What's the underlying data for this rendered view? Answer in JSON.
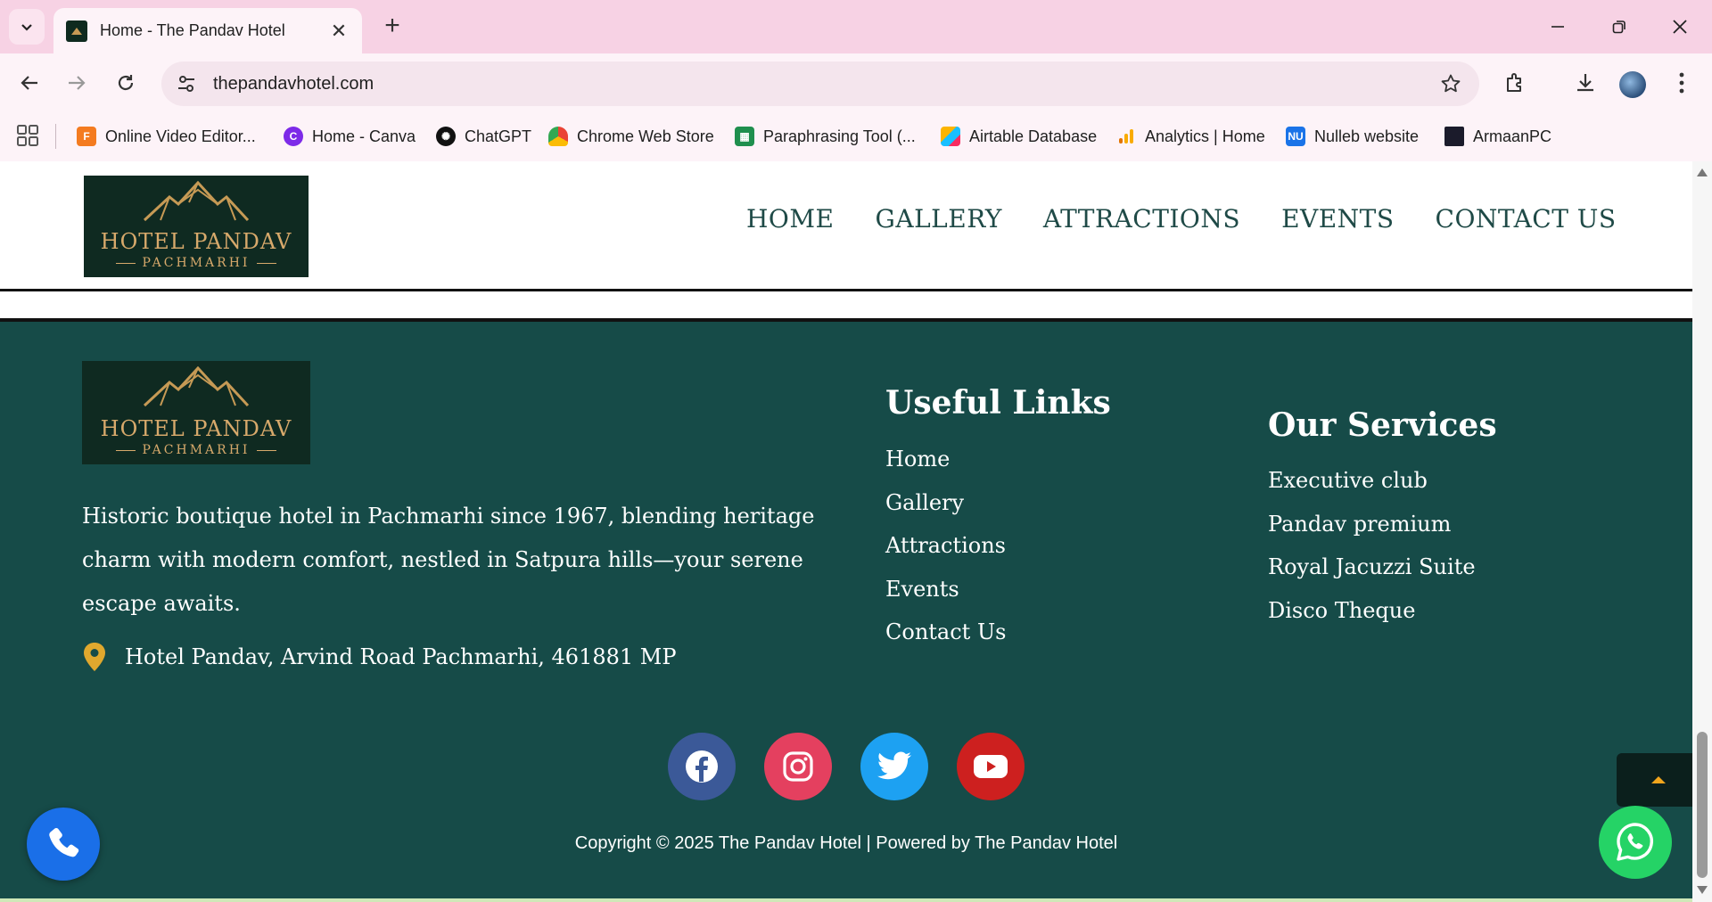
{
  "browser": {
    "tab_title": "Home - The Pandav Hotel",
    "url": "thepandavhotel.com",
    "bookmarks": [
      {
        "label": "Online Video Editor...",
        "icon": "video-editor-icon",
        "color": "#f47b20"
      },
      {
        "label": "Home - Canva",
        "icon": "canva-icon",
        "color": "#7d2ae8"
      },
      {
        "label": "ChatGPT",
        "icon": "chatgpt-icon",
        "color": "#111111"
      },
      {
        "label": "Chrome Web Store",
        "icon": "chrome-web-store-icon",
        "color": "#ea4335"
      },
      {
        "label": "Paraphrasing Tool (...",
        "icon": "paraphrasing-tool-icon",
        "color": "#1f8f4e"
      },
      {
        "label": "Airtable Database",
        "icon": "airtable-icon",
        "color": "#fcb400"
      },
      {
        "label": "Analytics | Home",
        "icon": "analytics-icon",
        "color": "#f9ab00"
      },
      {
        "label": "Nulleb website",
        "icon": "nulleb-icon",
        "color": "#1a73e8"
      },
      {
        "label": "ArmaanPC",
        "icon": "armaanpc-icon",
        "color": "#1b1b2b"
      }
    ],
    "nulleb_badge": "NU"
  },
  "header": {
    "logo": {
      "name": "HOTEL PANDAV",
      "sub": "PACHMARHI"
    },
    "nav": [
      "HOME",
      "GALLERY",
      "ATTRACTIONS",
      "EVENTS",
      "CONTACT US"
    ]
  },
  "footer": {
    "logo": {
      "name": "HOTEL PANDAV",
      "sub": "PACHMARHI"
    },
    "description": "Historic boutique hotel in Pachmarhi since 1967, blending heritage charm with modern comfort, nestled in Satpura hills—your serene escape awaits.",
    "address": "Hotel Pandav, Arvind Road Pachmarhi, 461881 MP",
    "useful_links": {
      "title": "Useful Links",
      "items": [
        "Home",
        "Gallery",
        "Attractions",
        "Events",
        "Contact Us"
      ]
    },
    "services": {
      "title": "Our Services",
      "items": [
        "Executive club",
        "Pandav premium",
        "Royal Jacuzzi Suite",
        "Disco Theque"
      ]
    },
    "social": [
      {
        "name": "facebook-icon",
        "color": "#3b5998"
      },
      {
        "name": "instagram-icon",
        "color": "#e4405f"
      },
      {
        "name": "twitter-icon",
        "color": "#1da1f2"
      },
      {
        "name": "youtube-icon",
        "color": "#cd201f"
      }
    ],
    "copyright": "Copyright © 2025 The Pandav Hotel | Powered by The Pandav Hotel"
  },
  "colors": {
    "footer_bg": "#164b48",
    "nav_text": "#1f4a47",
    "logo_gold": "#d7a96b",
    "back_to_top_arrow": "#f2a51c"
  }
}
